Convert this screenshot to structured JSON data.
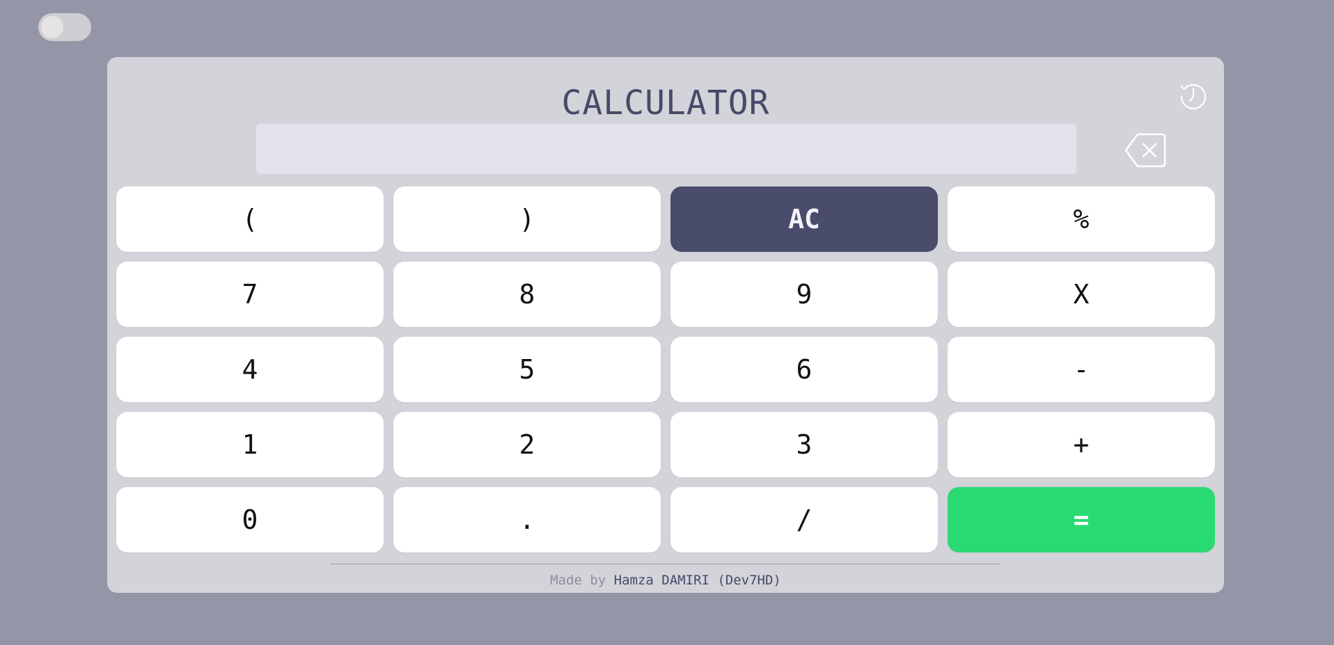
{
  "theme_toggle": {
    "state": "off"
  },
  "calculator": {
    "title": "CALCULATOR",
    "display": {
      "value": "",
      "placeholder": ""
    },
    "history_icon": "history-clock-icon",
    "backspace_icon": "backspace-icon"
  },
  "keys": [
    {
      "label": "(",
      "type": "normal"
    },
    {
      "label": ")",
      "type": "normal"
    },
    {
      "label": "AC",
      "type": "clear"
    },
    {
      "label": "%",
      "type": "normal"
    },
    {
      "label": "7",
      "type": "normal"
    },
    {
      "label": "8",
      "type": "normal"
    },
    {
      "label": "9",
      "type": "normal"
    },
    {
      "label": "X",
      "type": "normal"
    },
    {
      "label": "4",
      "type": "normal"
    },
    {
      "label": "5",
      "type": "normal"
    },
    {
      "label": "6",
      "type": "normal"
    },
    {
      "label": "-",
      "type": "normal"
    },
    {
      "label": "1",
      "type": "normal"
    },
    {
      "label": "2",
      "type": "normal"
    },
    {
      "label": "3",
      "type": "normal"
    },
    {
      "label": "+",
      "type": "normal"
    },
    {
      "label": "0",
      "type": "normal"
    },
    {
      "label": ".",
      "type": "normal"
    },
    {
      "label": "/",
      "type": "normal"
    },
    {
      "label": "=",
      "type": "equals"
    }
  ],
  "footer": {
    "made_by": "Made by",
    "author": "Hamza DAMIRI (Dev7HD)"
  },
  "colors": {
    "page_background": "#9495a6",
    "panel": "#d3d3da",
    "display": "#e3e3ee",
    "accent_dark": "#494c6b",
    "equals_green": "#29da73"
  }
}
